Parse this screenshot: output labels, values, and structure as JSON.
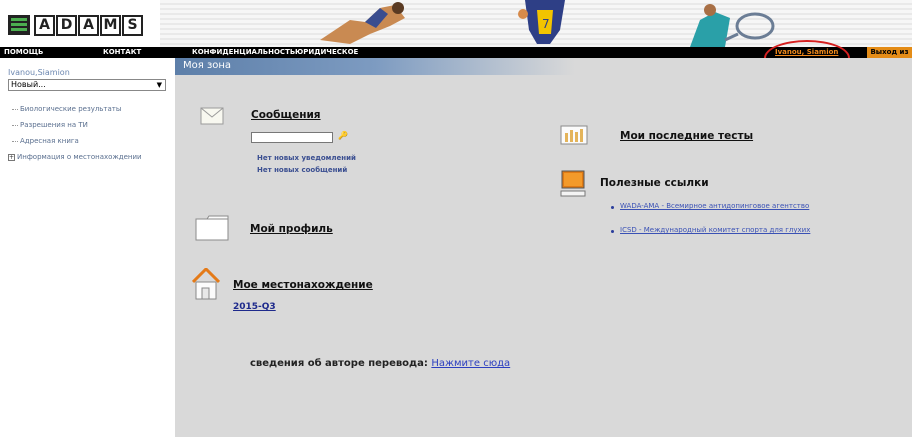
{
  "logo": {
    "mark": "≡",
    "letters": [
      "A",
      "D",
      "A",
      "M",
      "S"
    ]
  },
  "navbar": {
    "items": [
      "ПОМОЩЬ",
      "КОНТАКТ",
      "КОНФИДЕНЦИАЛЬНОСТЬ",
      "ЮРИДИЧЕСКОЕ"
    ],
    "user_link": "Ivanou, Siamion",
    "logout": "Выход из"
  },
  "sidebar": {
    "user_name": "Ivanou,Siamion",
    "select_value": "Новый...",
    "menu": [
      "Биологические результаты",
      "Разрешения на ТИ",
      "Адресная книга",
      "Информация о местонахождении"
    ],
    "expander_symbol": "+"
  },
  "main": {
    "zone_title": "Моя зона",
    "messages": {
      "title": "Сообщения",
      "notice_1": "Нет новых уведомлений",
      "notice_2": "Нет новых сообщений"
    },
    "profile": {
      "title": "Мой профиль"
    },
    "whereabouts": {
      "title": "Мое местонахождение",
      "quarter": "2015-Q3"
    },
    "tests": {
      "title": "Мои последние тесты"
    },
    "useful_links": {
      "title": "Полезные ссылки",
      "links": [
        "WADA-AMA - Всемирное антидопинговое агентство",
        "ICSD - Международный комитет спорта для глухих"
      ]
    },
    "translator": {
      "label": "сведения об авторе перевода:",
      "link": "Нажмите сюда"
    }
  },
  "colors": {
    "accent_orange": "#e48c17",
    "annotation_red": "#d62020",
    "zone_blue": "#5d7fa9",
    "main_background": "#d9d9d9"
  }
}
